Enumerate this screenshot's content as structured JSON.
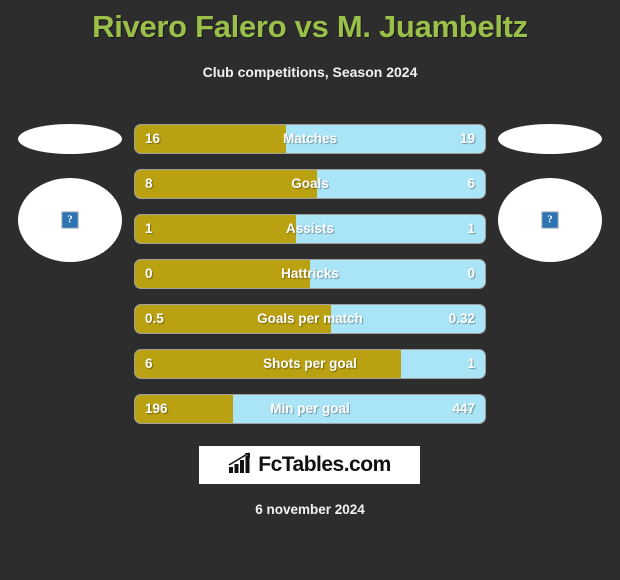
{
  "header": {
    "title": "Rivero Falero vs M. Juambeltz",
    "subtitle": "Club competitions, Season 2024",
    "title_color": "#9bc04a"
  },
  "players": {
    "home": {
      "photo_placeholder": "?",
      "crest_placeholder": ""
    },
    "away": {
      "photo_placeholder": "?",
      "crest_placeholder": ""
    }
  },
  "colors": {
    "background": "#2d2d2d",
    "home_bar": "#b9a112",
    "away_bar": "#a9e4f7"
  },
  "chart_data": {
    "type": "bar",
    "title": "Rivero Falero vs M. Juambeltz",
    "subtitle": "Club competitions, Season 2024",
    "orientation": "horizontal-diverging",
    "series": [
      {
        "name": "Rivero Falero",
        "color": "#b9a112",
        "values": [
          16,
          8,
          1,
          0,
          0.5,
          6,
          196
        ]
      },
      {
        "name": "M. Juambeltz",
        "color": "#a9e4f7",
        "values": [
          19,
          6,
          1,
          0,
          0.32,
          1,
          447
        ]
      }
    ],
    "categories": [
      "Matches",
      "Goals",
      "Assists",
      "Hattricks",
      "Goals per match",
      "Shots per goal",
      "Min per goal"
    ],
    "rows": [
      {
        "label": "Matches",
        "home": "16",
        "away": "19",
        "home_pct": 43
      },
      {
        "label": "Goals",
        "home": "8",
        "away": "6",
        "home_pct": 52
      },
      {
        "label": "Assists",
        "home": "1",
        "away": "1",
        "home_pct": 46
      },
      {
        "label": "Hattricks",
        "home": "0",
        "away": "0",
        "home_pct": 50
      },
      {
        "label": "Goals per match",
        "home": "0.5",
        "away": "0.32",
        "home_pct": 56
      },
      {
        "label": "Shots per goal",
        "home": "6",
        "away": "1",
        "home_pct": 76
      },
      {
        "label": "Min per goal",
        "home": "196",
        "away": "447",
        "home_pct": 28
      }
    ],
    "grid": false,
    "legend": "none"
  },
  "footer": {
    "logo_text": "FcTables.com",
    "logo_icon": "bar-chart-icon",
    "date": "6 november 2024"
  }
}
